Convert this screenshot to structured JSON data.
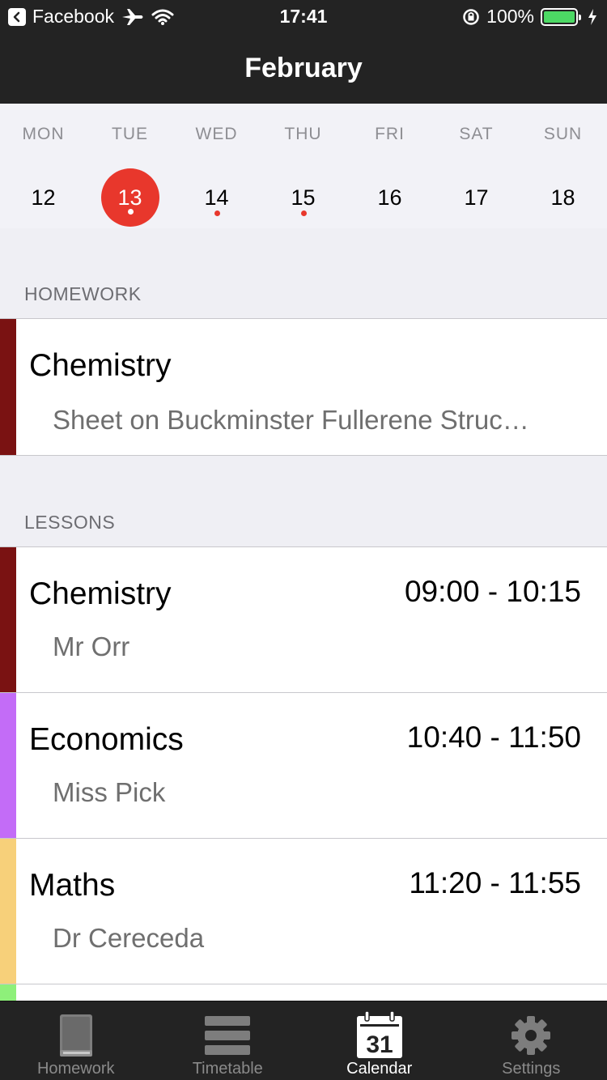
{
  "status_bar": {
    "back_app": "Facebook",
    "time": "17:41",
    "battery": "100%"
  },
  "nav": {
    "title": "February"
  },
  "week": [
    {
      "name": "MON",
      "num": "12",
      "selected": false,
      "dot": false
    },
    {
      "name": "TUE",
      "num": "13",
      "selected": true,
      "dot": true
    },
    {
      "name": "WED",
      "num": "14",
      "selected": false,
      "dot": true
    },
    {
      "name": "THU",
      "num": "15",
      "selected": false,
      "dot": true
    },
    {
      "name": "FRI",
      "num": "16",
      "selected": false,
      "dot": false
    },
    {
      "name": "SAT",
      "num": "17",
      "selected": false,
      "dot": false
    },
    {
      "name": "SUN",
      "num": "18",
      "selected": false,
      "dot": false
    }
  ],
  "homework": {
    "header": "HOMEWORK",
    "items": [
      {
        "title": "Chemistry",
        "subtitle": "Sheet on Buckminster Fullerene Struc…",
        "color": "#7a1212"
      }
    ]
  },
  "lessons": {
    "header": "LESSONS",
    "items": [
      {
        "title": "Chemistry",
        "teacher": "Mr Orr",
        "time": "09:00 - 10:15",
        "color": "#7a1212"
      },
      {
        "title": "Economics",
        "teacher": "Miss Pick",
        "time": "10:40 - 11:50",
        "color": "#c36cf7"
      },
      {
        "title": "Maths",
        "teacher": "Dr Cereceda",
        "time": "11:20 - 11:55",
        "color": "#f7d07a"
      },
      {
        "title": "",
        "teacher": "",
        "time": "",
        "color": "#8ef07a"
      }
    ]
  },
  "tabs": [
    {
      "label": "Homework",
      "icon": "book-icon",
      "active": false
    },
    {
      "label": "Timetable",
      "icon": "list-icon",
      "active": false
    },
    {
      "label": "Calendar",
      "icon": "calendar-icon",
      "active": true,
      "icon_text": "31"
    },
    {
      "label": "Settings",
      "icon": "gear-icon",
      "active": false
    }
  ],
  "colors": {
    "bar_background": "#232323",
    "accent_red": "#e8372c",
    "active_tab": "#ffffff",
    "inactive_tab": "#8a8a8a"
  }
}
